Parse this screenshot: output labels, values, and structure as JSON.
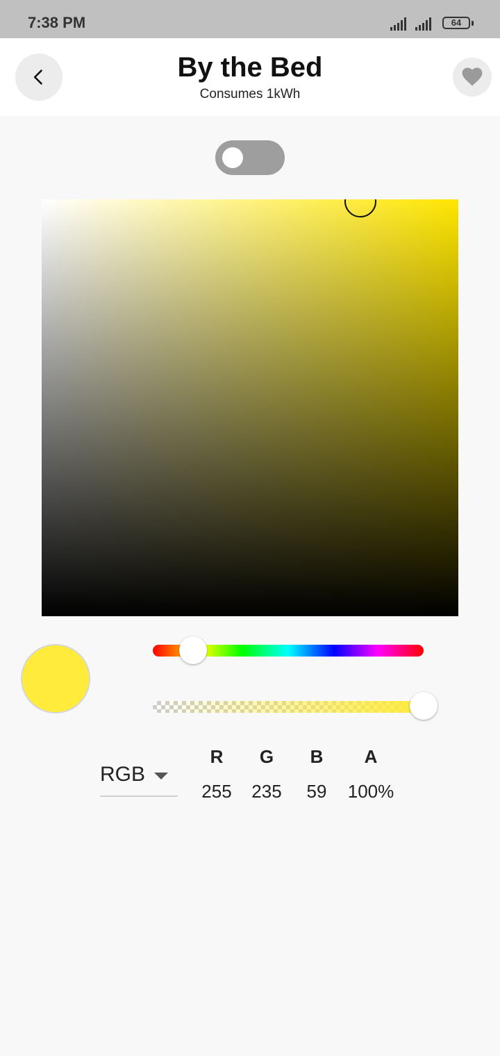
{
  "status_bar": {
    "time": "7:38 PM",
    "battery": "64"
  },
  "header": {
    "title": "By the Bed",
    "subtitle": "Consumes 1kWh",
    "back_icon": "chevron-left-icon",
    "favorite_icon": "heart-icon"
  },
  "power_toggle": {
    "on": false
  },
  "color_picker": {
    "selected_color": "#ffeb3b",
    "hue_fraction": 0.15,
    "alpha_fraction": 1.0,
    "mode": "RGB",
    "channels": [
      {
        "label": "R",
        "value": "255"
      },
      {
        "label": "G",
        "value": "235"
      },
      {
        "label": "B",
        "value": "59"
      },
      {
        "label": "A",
        "value": "100%"
      }
    ]
  }
}
